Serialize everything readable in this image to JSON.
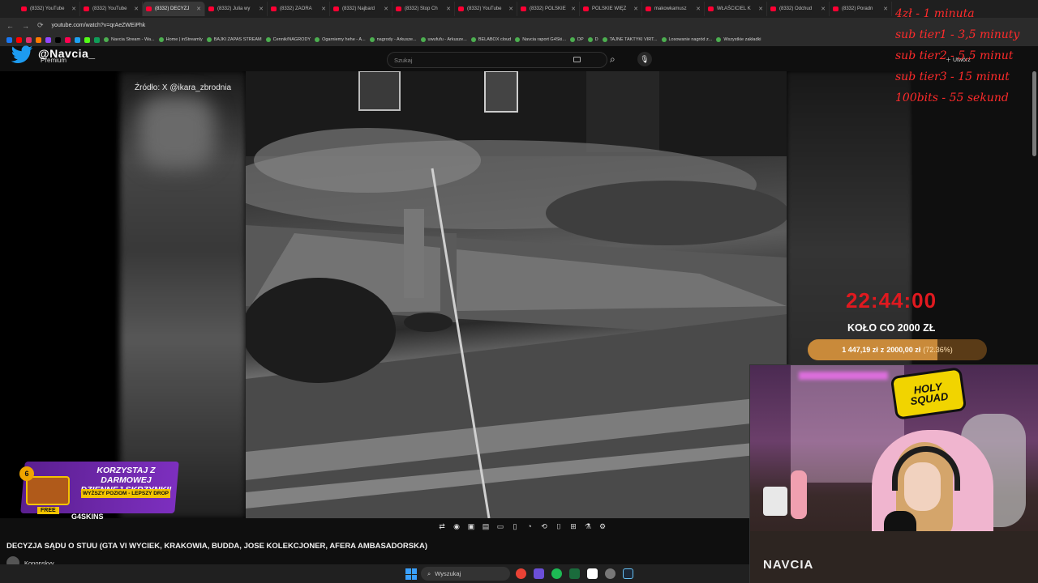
{
  "browser": {
    "tabs": [
      "(8332) YouTube",
      "(8332) YouTube",
      "(8332) DECYZJ",
      "(8332) Julia wy",
      "(8332) ZAORA",
      "(8332) Najbard",
      "(8332) Stop Ch",
      "(8332) YouTube",
      "(8332) POLSKIE",
      "POLSKIE WIĘZ",
      "makowkamusz",
      "WŁAŚCICIEL K",
      "(8332) Odchud",
      "(8332) Poradn"
    ],
    "active_tab": 2,
    "url": "youtube.com/watch?v=qrAeZWEiPhk",
    "bookmarks": [
      "Navcia Stream - Wa...",
      "Home | inStreamly",
      "BAJKI ZAPAS STREAM",
      "Cennik/NAGRODY",
      "Ogarniemy hehe - A...",
      "nagrody - Arkusze...",
      "uwufufu - Arkusze...",
      "BELABOX cloud",
      "Navcia raport G4Ski...",
      "DP",
      "D",
      "TAJNE TAKTYKI VIRT...",
      "Losowanie nagród z...",
      "Wszystkie zakładki"
    ]
  },
  "youtube": {
    "premium_label": "Premium",
    "search_placeholder": "Szukaj",
    "create_label": "Utwórz",
    "video_title": "DECYZJA SĄDU O STUU (GTA VI WYCIEK, KRAKOWIA, BUDDA, JOSE KOLEKCJONER, AFERA AMBASADORSKA)",
    "channel_name": "Konopskyy",
    "source_caption": "Źródło: X @ikara_zbrodnia"
  },
  "overlay": {
    "handle": "@Navcia_",
    "sub_notes": [
      "4zł - 1 minuta",
      "sub tier1 - 3,5 minuty",
      "sub tier2 - 5,5 minut",
      "sub tier3 - 15 minut",
      "100bits - 55 sekund"
    ],
    "timer": "22:44:00",
    "wheel_label": "KOŁO CO 2000 ZŁ",
    "goal": {
      "current": "1 447,19 zł",
      "separator": "z",
      "target": "2000,00 zł",
      "percent_text": "(72.36%)",
      "fraction": 0.7236
    },
    "holy_squad": [
      "HOLY",
      "SQUAD"
    ],
    "cam_watermark": "NAVCIA"
  },
  "promo": {
    "level": "6",
    "title": "KORZYSTAJ Z DARMOWEJ DZIENNEJ SKRZYNKI!",
    "subtitle": "WYŻSZY POZIOM - LEPSZY DROP",
    "free_label": "FREE",
    "brand": "G4SKINS"
  },
  "taskbar": {
    "search_label": "Wyszukaj"
  },
  "colors": {
    "accent_red": "#e0191f",
    "notes_red": "#ff2b2b",
    "goal_fill": "#c98a3a",
    "promo_purple": "#7d2fbf",
    "promo_yellow": "#f3c400",
    "youtube_red": "#ff0033"
  }
}
